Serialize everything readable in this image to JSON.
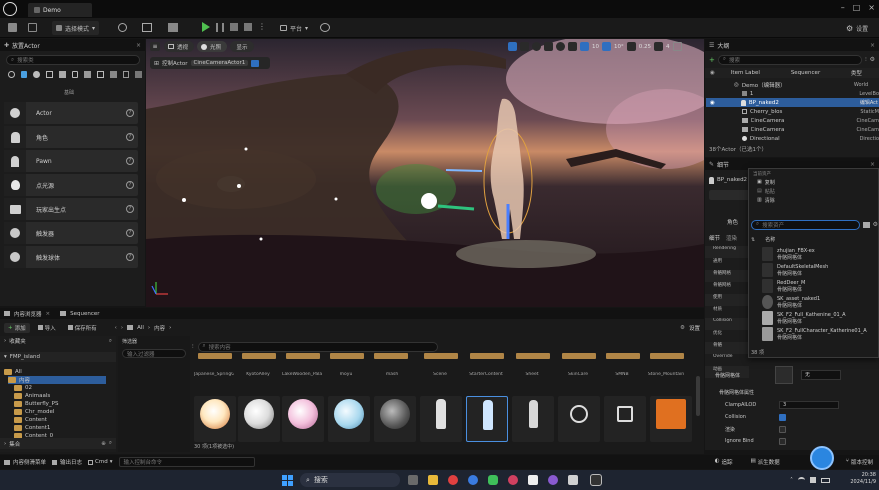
{
  "app": {
    "project_tab": "Demo"
  },
  "toolbar": {
    "mode": "选择模式",
    "platform": "平台",
    "settings": "设置"
  },
  "place_actors": {
    "title": "放置Actor",
    "search_placeholder": "搜索类",
    "category": "基础",
    "items": [
      {
        "label": "Actor",
        "icon": "actor-sphere-icon"
      },
      {
        "label": "角色",
        "icon": "character-icon"
      },
      {
        "label": "Pawn",
        "icon": "pawn-icon"
      },
      {
        "label": "点光源",
        "icon": "point-light-icon"
      },
      {
        "label": "玩家出生点",
        "icon": "player-start-icon"
      },
      {
        "label": "触发器",
        "icon": "cube-trigger-icon"
      },
      {
        "label": "触发球体",
        "icon": "sphere-trigger-icon"
      }
    ]
  },
  "viewport": {
    "perspective": "透视",
    "lit": "光照",
    "show": "显示",
    "pilot_text": "控制Actor",
    "camera_name": "CineCameraActor1",
    "snap_value": "10",
    "angle_value": "10°",
    "scale_value": "0.25",
    "speed_value": "4"
  },
  "outliner": {
    "title": "大纲",
    "search_placeholder": "搜索",
    "col_label": "Item Label",
    "col_sequencer": "Sequencer",
    "col_type": "类型",
    "rows": [
      {
        "label": "Demo（编辑器）",
        "type": "World",
        "selected": false
      },
      {
        "label": "1",
        "type": "LevelBo",
        "selected": false
      },
      {
        "label": "BP_naked2",
        "type": "编辑Act",
        "selected": true
      },
      {
        "label": "Cherry_blos",
        "type": "StaticM",
        "selected": false
      },
      {
        "label": "CineCamera",
        "type": "CineCam",
        "selected": false
      },
      {
        "label": "CineCamera",
        "type": "CineCam",
        "selected": false
      },
      {
        "label": "Directional",
        "type": "Directio",
        "selected": false
      }
    ],
    "footer": "38个Actor（已选1个）"
  },
  "details": {
    "title": "细节",
    "actor_name": "BP_naked2",
    "sub_label": "角色",
    "tabs": [
      "细节",
      "渲染"
    ],
    "rows": [
      "Rendering",
      "通用",
      "骨骼网格",
      "骨骼网格",
      "使用",
      "材质",
      "Collision",
      "优化",
      "骨骼",
      "Override",
      "动画"
    ],
    "bottom_rows": [
      {
        "label": "骨骼网格体",
        "value": "无"
      },
      {
        "label": "骨骼网格体属性",
        "value": ""
      },
      {
        "label": "ClampAlLOD",
        "value": "3"
      },
      {
        "label": "Collision",
        "value": ""
      },
      {
        "label": "渲染",
        "value": ""
      },
      {
        "label": "Ignore Bind",
        "value": ""
      }
    ]
  },
  "context_menu": {
    "header": "当前资产",
    "actions": [
      "复制",
      "粘贴",
      "清除"
    ],
    "search_placeholder": "搜索资产",
    "column": "名称",
    "assets": [
      {
        "name": "zhujian_FBX-ex",
        "type": "骨骼网格体"
      },
      {
        "name": "DefaultSkeletalMesh",
        "type": "骨骼网格体"
      },
      {
        "name": "RedDeer_M",
        "type": "骨骼网格体"
      },
      {
        "name": "SK_asset_naked1",
        "type": "骨骼网格体"
      },
      {
        "name": "SK_F2_Full_Kathenine_01_A",
        "type": "骨骼网格体"
      },
      {
        "name": "SK_F2_FullCharacter_Katherine01_A",
        "type": "骨骼网格体"
      }
    ],
    "count": "38 项"
  },
  "content_browser": {
    "tab1": "内容浏览器",
    "tab2": "Sequencer",
    "add": "添加",
    "import": "导入",
    "save_all": "保存所有",
    "path": [
      "All",
      "内容"
    ],
    "settings": "设置",
    "favorites": "收藏夹",
    "project": "FMP_island",
    "collections": "集合",
    "search_placeholder": "搜索内容",
    "filter_label": "筛选器",
    "filter_placeholder": "输入过滤器",
    "tree": [
      "All",
      "内容",
      "02",
      "Animaals",
      "Butterfly_PS",
      "Chr_model",
      "Content",
      "Content1",
      "Content_0"
    ],
    "folders": [
      "Japanese_SpringGrass_AncTree",
      "KyotoAlley",
      "LakeWooden_Palace",
      "moyu",
      "mash",
      "Scene",
      "StarterContent",
      "Sheet",
      "SkinCare",
      "SMNB",
      "Stone_Mountain",
      "Stylized_Mountain"
    ],
    "status": "30 项(1项被选中)"
  },
  "status_bar": {
    "drawer": "内容侧滑菜单",
    "output_log": "输出日志",
    "cmd": "Cmd",
    "console_placeholder": "输入控制台命令",
    "trace": "追踪",
    "derived": "派生数据",
    "source_control": "版本控制"
  },
  "taskbar": {
    "search": "搜索",
    "time": "20:38",
    "date": "2024/11/9"
  }
}
